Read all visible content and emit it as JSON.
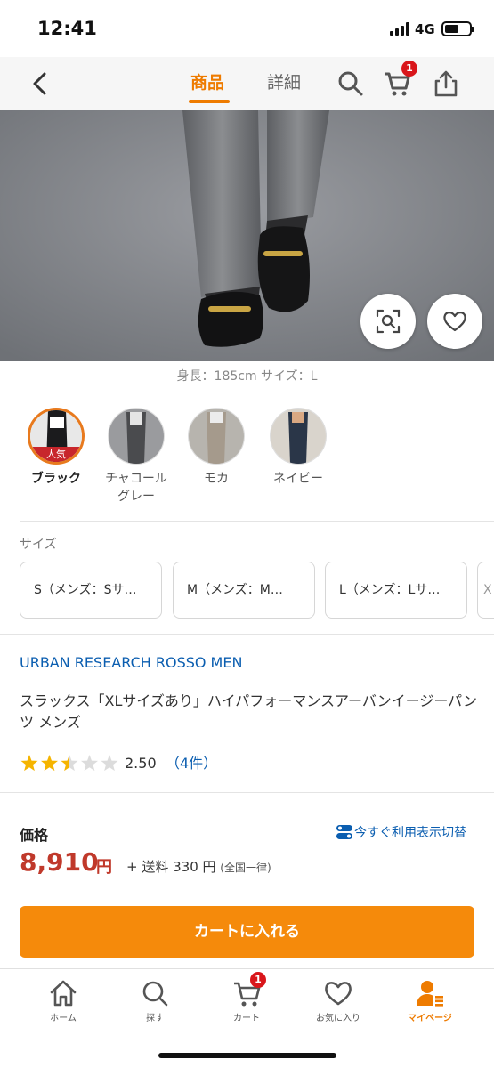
{
  "status_bar": {
    "time": "12:41",
    "network": "4G"
  },
  "header": {
    "tabs": [
      {
        "label": "商品",
        "active": true
      },
      {
        "label": "詳細",
        "active": false
      }
    ],
    "cart_badge": "1",
    "accent_color": "#ee7b00"
  },
  "hero": {
    "model_info": "身長：185cm サイズ：L"
  },
  "colors": {
    "items": [
      {
        "name": "ブラック",
        "badge": "人気",
        "selected": true
      },
      {
        "name": "チャコール\nグレー",
        "selected": false
      },
      {
        "name": "モカ",
        "selected": false
      },
      {
        "name": "ネイビー",
        "selected": false
      }
    ]
  },
  "sizes": {
    "label": "サイズ",
    "items": [
      {
        "label": "S（メンズ：Sサ…"
      },
      {
        "label": "M（メンズ：M…"
      },
      {
        "label": "L（メンズ：Lサ…"
      }
    ],
    "more_label": "X"
  },
  "product": {
    "brand": "URBAN RESEARCH ROSSO MEN",
    "name": "スラックス「XLサイズあり」ハイパフォーマンスアーバンイージーパンツ メンズ",
    "rating": 2.5,
    "rating_text": "2.50",
    "review_count": "（4件）"
  },
  "price": {
    "label": "価格",
    "switch_link": "今すぐ利用表示切替",
    "amount": "8,910",
    "unit": "円",
    "shipping": "+ 送料 330 円",
    "shipping_note": "(全国一律)",
    "price_color": "#c0392b"
  },
  "cart_button": {
    "label": "カートに入れる",
    "color": "#f58a0b"
  },
  "bottom_nav": {
    "items": [
      {
        "label": "ホーム",
        "icon": "home-icon"
      },
      {
        "label": "探す",
        "icon": "search-icon"
      },
      {
        "label": "カート",
        "icon": "cart-icon",
        "badge": "1"
      },
      {
        "label": "お気に入り",
        "icon": "heart-icon"
      },
      {
        "label": "マイページ",
        "icon": "user-icon",
        "active": true
      }
    ]
  }
}
